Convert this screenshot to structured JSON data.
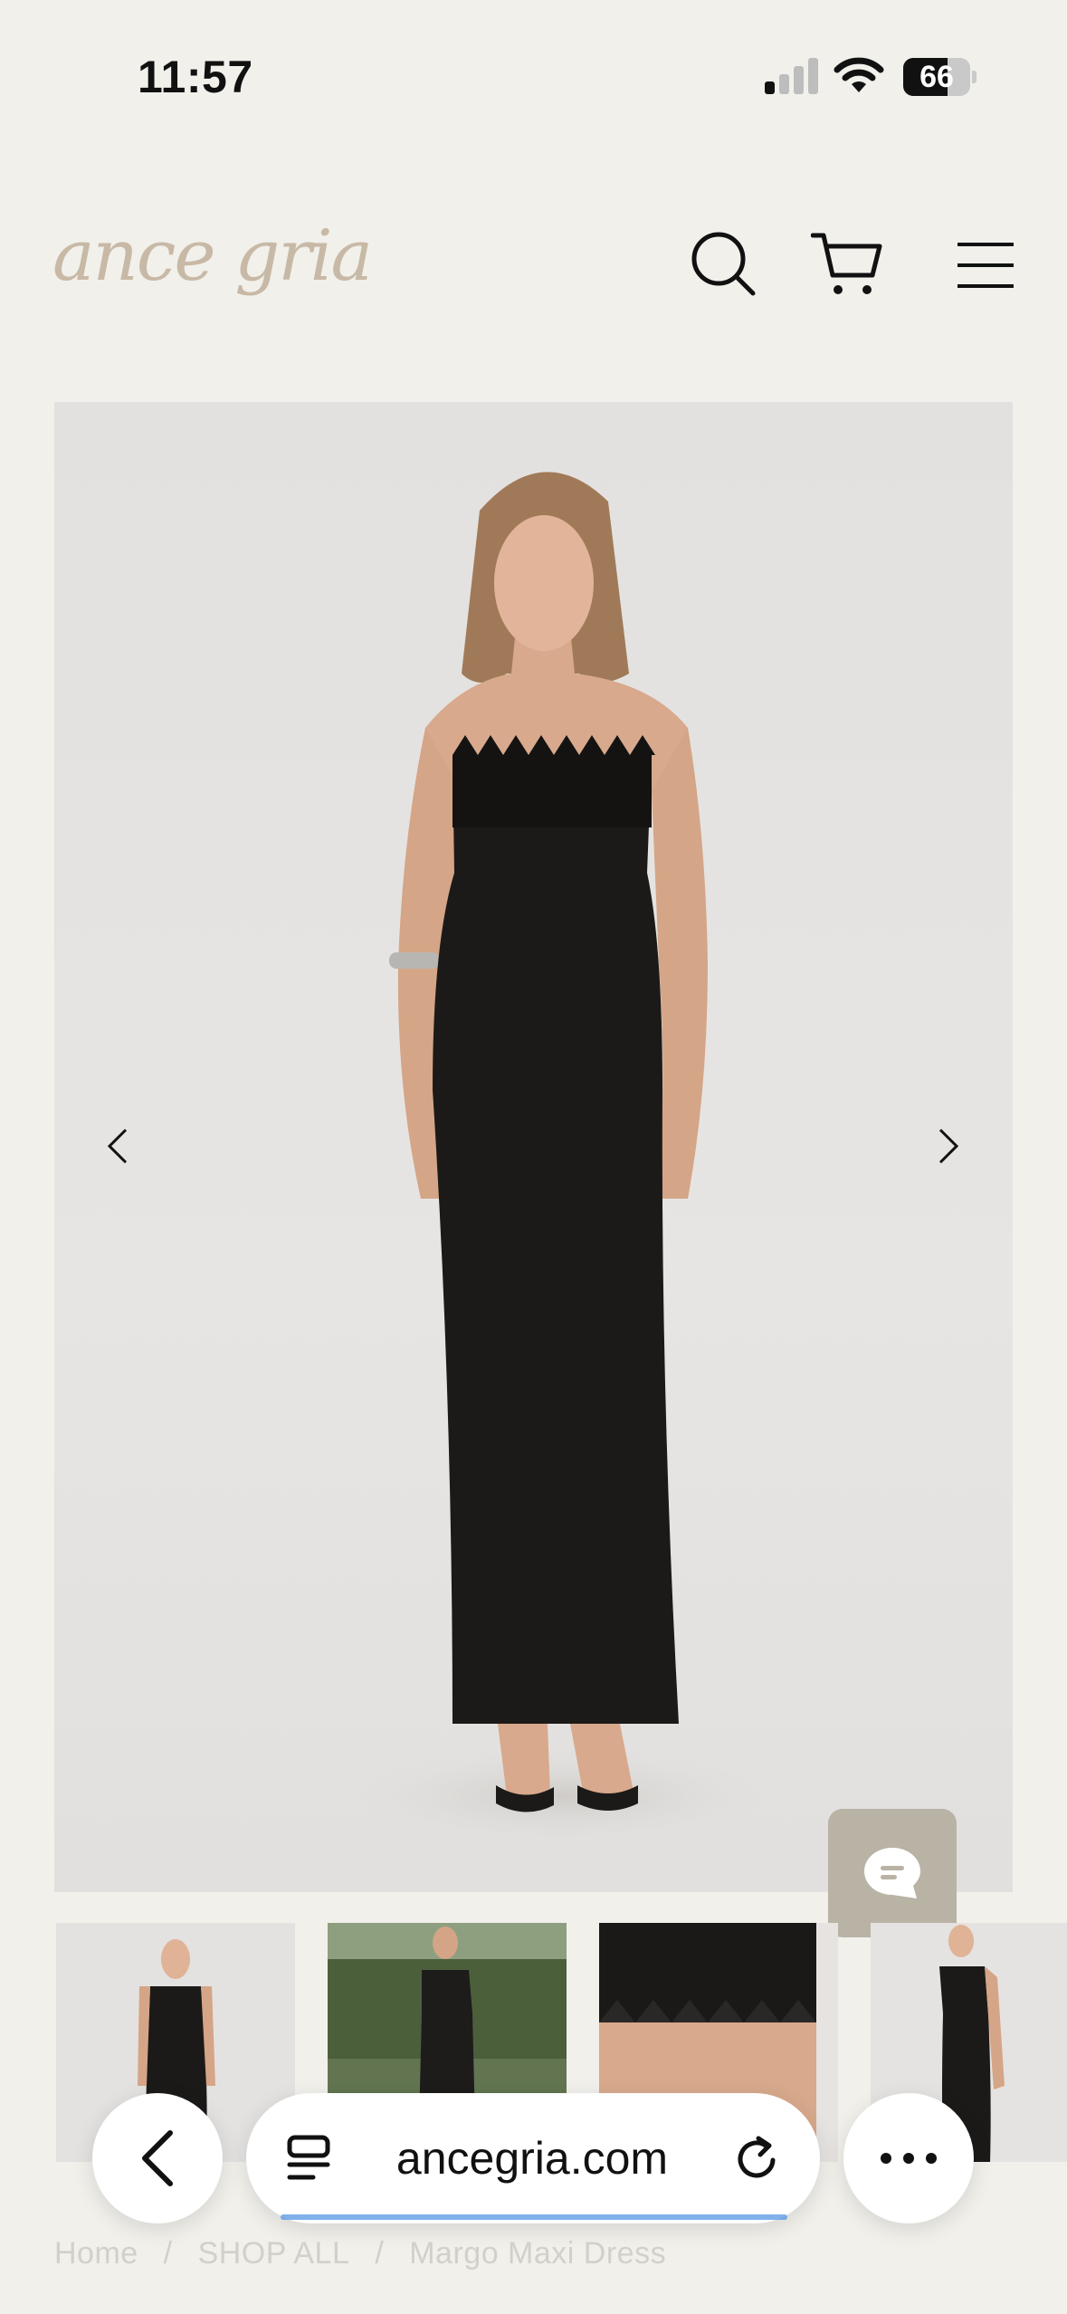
{
  "status_bar": {
    "time": "11:57",
    "battery": "66"
  },
  "header": {
    "logo": "ance gria"
  },
  "product": {
    "gallery_count": 4
  },
  "browser": {
    "url": "ancegria.com"
  },
  "breadcrumb": {
    "home": "Home",
    "sep": "/",
    "category": "SHOP ALL",
    "current": "Margo Maxi Dress"
  },
  "colors": {
    "background": "#f1f0eb",
    "logo": "#c8b9a6",
    "chat": "#b9b3a6",
    "progress": "#4a90e2"
  }
}
